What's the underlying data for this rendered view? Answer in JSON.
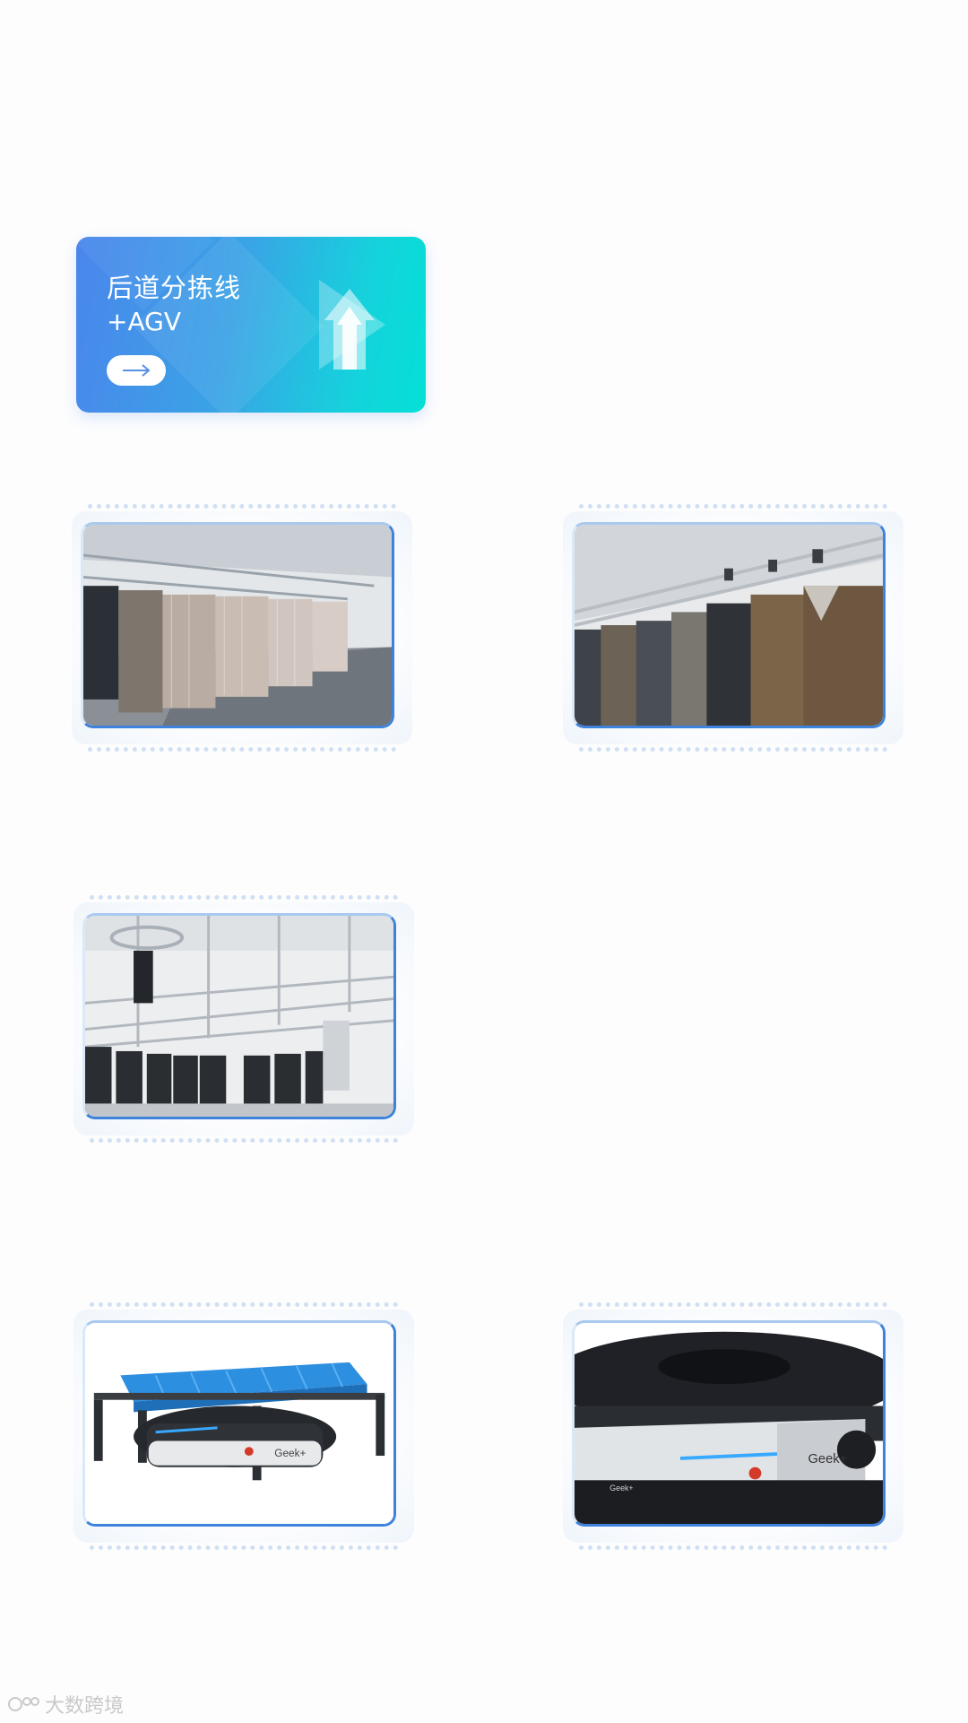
{
  "hero": {
    "title": "后道分拣线",
    "subtitle": "+AGV",
    "button_icon": "arrow-right-icon",
    "logo_icon": "upload-arrow-icon",
    "gradient_start": "#4a86ec",
    "gradient_end": "#04e0d6"
  },
  "tiles": [
    {
      "name": "sorting-line-photo-1",
      "subject": "hanging-garment-conveyor"
    },
    {
      "name": "sorting-line-photo-2",
      "subject": "hanging-suits-closeup"
    },
    {
      "name": "sorting-line-photo-3",
      "subject": "overhead-rail-system"
    },
    {
      "name": "agv-photo-1",
      "subject": "agv-with-blue-pallet"
    },
    {
      "name": "agv-photo-2",
      "subject": "agv-closeup"
    }
  ],
  "agv_brand_label": "Geek+",
  "watermark": {
    "text": "大数跨境"
  },
  "colors": {
    "frame_border": "#3d82dc",
    "dash": "#cfe0f4"
  }
}
